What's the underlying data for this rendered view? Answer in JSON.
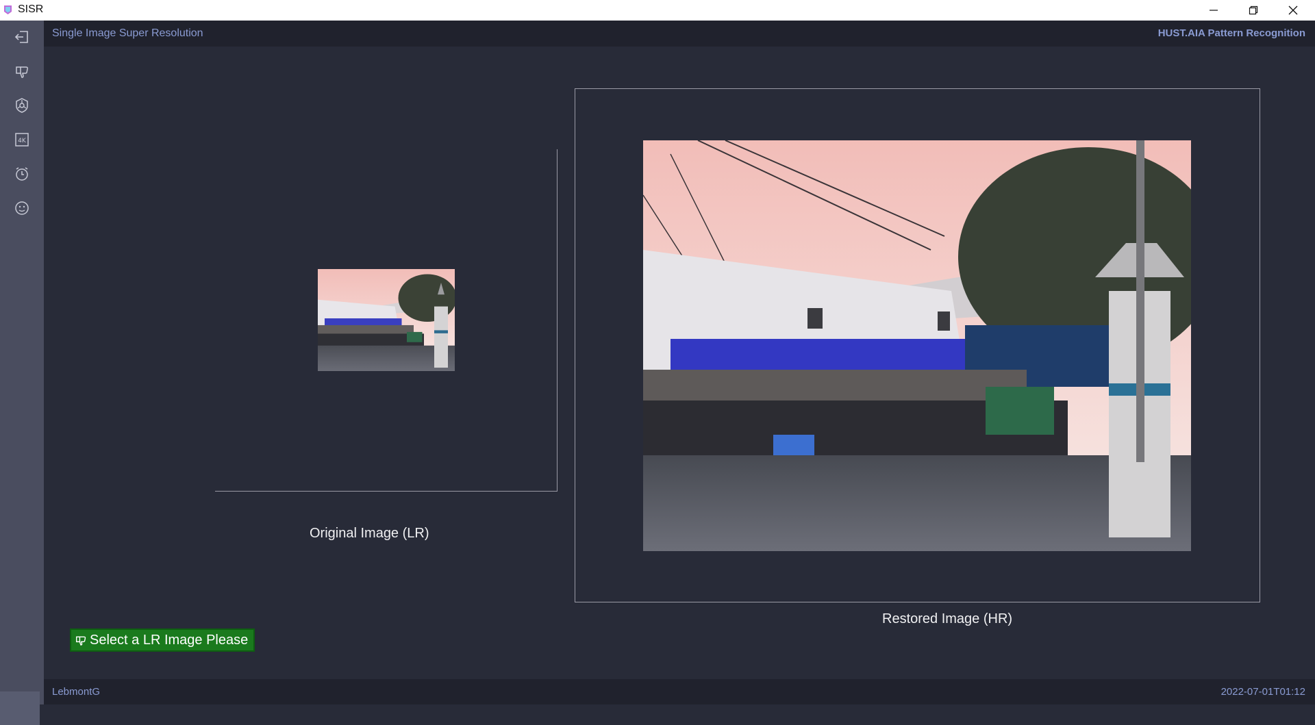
{
  "window": {
    "title": "SISR",
    "controls": [
      "minimize-icon",
      "restore-icon",
      "close-icon"
    ]
  },
  "header": {
    "app_name": "Single Image Super Resolution",
    "organization": "HUST.AIA Pattern  Recognition"
  },
  "sidebar": {
    "items": [
      {
        "icon": "sign-out-icon"
      },
      {
        "icon": "thumbs-down-icon"
      },
      {
        "icon": "shield-icon"
      },
      {
        "icon": "4k-icon"
      },
      {
        "icon": "alarm-clock-icon"
      },
      {
        "icon": "smiley-icon"
      }
    ]
  },
  "main": {
    "lr_caption": "Original Image (LR)",
    "hr_caption": "Restored Image (HR)",
    "select_button": "Select a LR Image Please"
  },
  "footer": {
    "author": "LebmontG",
    "timestamp": "2022-07-01T01:12"
  },
  "colors": {
    "background": "#282b38",
    "sidebar": "#4a4d5f",
    "accent_text": "#8a9bd2",
    "button_green": "#1a7a1d"
  }
}
